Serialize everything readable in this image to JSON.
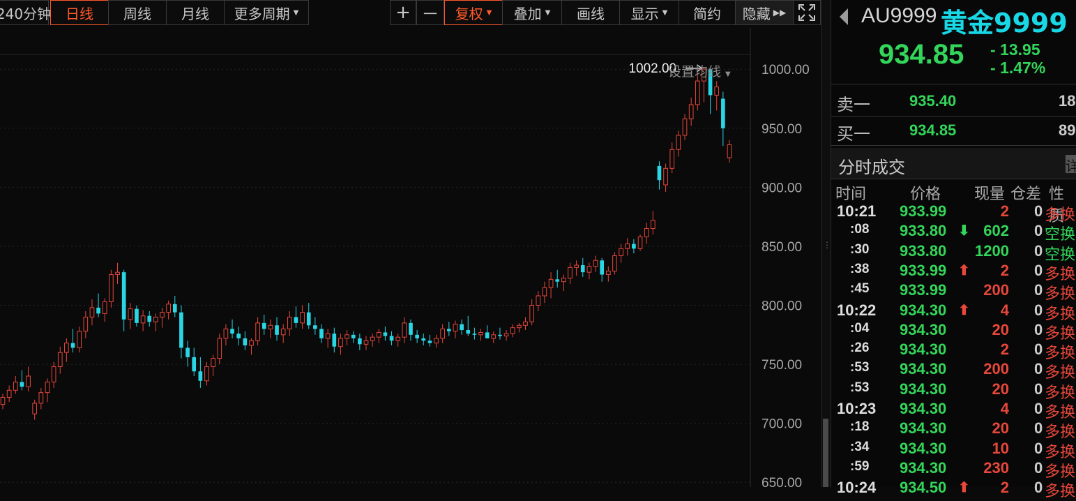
{
  "toolbar": {
    "period_240": "240分钟",
    "daily": "日线",
    "weekly": "周线",
    "monthly": "月线",
    "more_periods": "更多周期",
    "zoom_in": "+",
    "zoom_out": "一",
    "adjust": "复权",
    "overlay": "叠加",
    "draw": "画线",
    "display": "显示",
    "simple": "简约",
    "hide": "隐藏",
    "expand_icon": "expand-icon",
    "accent_color": "#ff5a2a"
  },
  "chart": {
    "ma_setting_label": "设置均线",
    "max_label": "1002.00",
    "y_ticks": [
      "1000.00",
      "950.00",
      "900.00",
      "850.00",
      "800.00",
      "750.00",
      "700.00",
      "650.00"
    ],
    "up_color": "#e8473b",
    "down_color": "#2ad6e4"
  },
  "chart_data": {
    "type": "candlestick",
    "y_ticks": [
      1000,
      950,
      900,
      850,
      800,
      750,
      700,
      650
    ],
    "ylim": [
      646,
      1035
    ],
    "highest_annotation": 1002.0,
    "candles": [
      {
        "o": 716,
        "h": 725,
        "l": 712,
        "c": 722
      },
      {
        "o": 722,
        "h": 732,
        "l": 718,
        "c": 728
      },
      {
        "o": 728,
        "h": 740,
        "l": 725,
        "c": 735
      },
      {
        "o": 735,
        "h": 745,
        "l": 728,
        "c": 731
      },
      {
        "o": 731,
        "h": 748,
        "l": 727,
        "c": 740
      },
      {
        "o": 708,
        "h": 720,
        "l": 703,
        "c": 717
      },
      {
        "o": 717,
        "h": 730,
        "l": 712,
        "c": 726
      },
      {
        "o": 726,
        "h": 738,
        "l": 718,
        "c": 735
      },
      {
        "o": 735,
        "h": 752,
        "l": 730,
        "c": 748
      },
      {
        "o": 748,
        "h": 765,
        "l": 742,
        "c": 760
      },
      {
        "o": 760,
        "h": 772,
        "l": 752,
        "c": 768
      },
      {
        "o": 768,
        "h": 780,
        "l": 760,
        "c": 764
      },
      {
        "o": 764,
        "h": 782,
        "l": 760,
        "c": 778
      },
      {
        "o": 778,
        "h": 795,
        "l": 772,
        "c": 790
      },
      {
        "o": 790,
        "h": 805,
        "l": 783,
        "c": 798
      },
      {
        "o": 798,
        "h": 810,
        "l": 790,
        "c": 793
      },
      {
        "o": 793,
        "h": 806,
        "l": 786,
        "c": 803
      },
      {
        "o": 803,
        "h": 830,
        "l": 798,
        "c": 826
      },
      {
        "o": 826,
        "h": 836,
        "l": 818,
        "c": 828
      },
      {
        "o": 828,
        "h": 830,
        "l": 778,
        "c": 788
      },
      {
        "o": 788,
        "h": 802,
        "l": 780,
        "c": 797
      },
      {
        "o": 797,
        "h": 800,
        "l": 782,
        "c": 785
      },
      {
        "o": 785,
        "h": 796,
        "l": 778,
        "c": 791
      },
      {
        "o": 791,
        "h": 795,
        "l": 782,
        "c": 786
      },
      {
        "o": 786,
        "h": 793,
        "l": 778,
        "c": 790
      },
      {
        "o": 790,
        "h": 798,
        "l": 781,
        "c": 794
      },
      {
        "o": 794,
        "h": 804,
        "l": 788,
        "c": 801
      },
      {
        "o": 801,
        "h": 808,
        "l": 790,
        "c": 794
      },
      {
        "o": 794,
        "h": 800,
        "l": 755,
        "c": 764
      },
      {
        "o": 764,
        "h": 770,
        "l": 748,
        "c": 756
      },
      {
        "o": 756,
        "h": 764,
        "l": 740,
        "c": 744
      },
      {
        "o": 744,
        "h": 756,
        "l": 730,
        "c": 736
      },
      {
        "o": 736,
        "h": 752,
        "l": 732,
        "c": 748
      },
      {
        "o": 748,
        "h": 758,
        "l": 740,
        "c": 755
      },
      {
        "o": 755,
        "h": 776,
        "l": 750,
        "c": 772
      },
      {
        "o": 772,
        "h": 784,
        "l": 766,
        "c": 780
      },
      {
        "o": 780,
        "h": 788,
        "l": 772,
        "c": 776
      },
      {
        "o": 776,
        "h": 782,
        "l": 766,
        "c": 772
      },
      {
        "o": 772,
        "h": 778,
        "l": 762,
        "c": 766
      },
      {
        "o": 766,
        "h": 772,
        "l": 758,
        "c": 770
      },
      {
        "o": 770,
        "h": 790,
        "l": 766,
        "c": 785
      },
      {
        "o": 785,
        "h": 792,
        "l": 775,
        "c": 780
      },
      {
        "o": 780,
        "h": 788,
        "l": 772,
        "c": 783
      },
      {
        "o": 783,
        "h": 790,
        "l": 770,
        "c": 775
      },
      {
        "o": 775,
        "h": 784,
        "l": 768,
        "c": 780
      },
      {
        "o": 780,
        "h": 795,
        "l": 774,
        "c": 790
      },
      {
        "o": 790,
        "h": 799,
        "l": 781,
        "c": 785
      },
      {
        "o": 785,
        "h": 800,
        "l": 780,
        "c": 794
      },
      {
        "o": 794,
        "h": 802,
        "l": 780,
        "c": 783
      },
      {
        "o": 783,
        "h": 790,
        "l": 775,
        "c": 780
      },
      {
        "o": 780,
        "h": 784,
        "l": 768,
        "c": 772
      },
      {
        "o": 772,
        "h": 780,
        "l": 764,
        "c": 776
      },
      {
        "o": 776,
        "h": 781,
        "l": 760,
        "c": 765
      },
      {
        "o": 765,
        "h": 776,
        "l": 758,
        "c": 772
      },
      {
        "o": 772,
        "h": 779,
        "l": 766,
        "c": 775
      },
      {
        "o": 775,
        "h": 778,
        "l": 768,
        "c": 772
      },
      {
        "o": 772,
        "h": 776,
        "l": 762,
        "c": 767
      },
      {
        "o": 767,
        "h": 774,
        "l": 762,
        "c": 770
      },
      {
        "o": 770,
        "h": 776,
        "l": 765,
        "c": 773
      },
      {
        "o": 773,
        "h": 780,
        "l": 768,
        "c": 777
      },
      {
        "o": 777,
        "h": 782,
        "l": 770,
        "c": 774
      },
      {
        "o": 774,
        "h": 778,
        "l": 766,
        "c": 770
      },
      {
        "o": 770,
        "h": 776,
        "l": 765,
        "c": 773
      },
      {
        "o": 773,
        "h": 790,
        "l": 768,
        "c": 785
      },
      {
        "o": 785,
        "h": 788,
        "l": 770,
        "c": 775
      },
      {
        "o": 775,
        "h": 779,
        "l": 768,
        "c": 772
      },
      {
        "o": 772,
        "h": 776,
        "l": 766,
        "c": 770
      },
      {
        "o": 770,
        "h": 775,
        "l": 765,
        "c": 768
      },
      {
        "o": 768,
        "h": 775,
        "l": 764,
        "c": 772
      },
      {
        "o": 772,
        "h": 784,
        "l": 768,
        "c": 780
      },
      {
        "o": 780,
        "h": 786,
        "l": 774,
        "c": 778
      },
      {
        "o": 778,
        "h": 787,
        "l": 772,
        "c": 784
      },
      {
        "o": 784,
        "h": 788,
        "l": 775,
        "c": 779
      },
      {
        "o": 779,
        "h": 791,
        "l": 774,
        "c": 776
      },
      {
        "o": 776,
        "h": 781,
        "l": 771,
        "c": 775
      },
      {
        "o": 775,
        "h": 780,
        "l": 770,
        "c": 777
      },
      {
        "o": 777,
        "h": 783,
        "l": 772,
        "c": 772
      },
      {
        "o": 772,
        "h": 778,
        "l": 768,
        "c": 775
      },
      {
        "o": 775,
        "h": 781,
        "l": 771,
        "c": 774
      },
      {
        "o": 774,
        "h": 779,
        "l": 770,
        "c": 776
      },
      {
        "o": 776,
        "h": 784,
        "l": 773,
        "c": 781
      },
      {
        "o": 781,
        "h": 785,
        "l": 777,
        "c": 783
      },
      {
        "o": 783,
        "h": 790,
        "l": 779,
        "c": 786
      },
      {
        "o": 786,
        "h": 805,
        "l": 783,
        "c": 800
      },
      {
        "o": 800,
        "h": 812,
        "l": 795,
        "c": 808
      },
      {
        "o": 808,
        "h": 820,
        "l": 802,
        "c": 815
      },
      {
        "o": 815,
        "h": 828,
        "l": 806,
        "c": 822
      },
      {
        "o": 822,
        "h": 830,
        "l": 815,
        "c": 820
      },
      {
        "o": 820,
        "h": 826,
        "l": 812,
        "c": 823
      },
      {
        "o": 823,
        "h": 836,
        "l": 818,
        "c": 832
      },
      {
        "o": 832,
        "h": 838,
        "l": 825,
        "c": 834
      },
      {
        "o": 834,
        "h": 840,
        "l": 824,
        "c": 828
      },
      {
        "o": 828,
        "h": 836,
        "l": 822,
        "c": 833
      },
      {
        "o": 833,
        "h": 842,
        "l": 828,
        "c": 838
      },
      {
        "o": 838,
        "h": 840,
        "l": 820,
        "c": 826
      },
      {
        "o": 826,
        "h": 833,
        "l": 820,
        "c": 829
      },
      {
        "o": 829,
        "h": 845,
        "l": 826,
        "c": 842
      },
      {
        "o": 842,
        "h": 852,
        "l": 836,
        "c": 848
      },
      {
        "o": 848,
        "h": 857,
        "l": 842,
        "c": 852
      },
      {
        "o": 852,
        "h": 856,
        "l": 844,
        "c": 848
      },
      {
        "o": 848,
        "h": 860,
        "l": 846,
        "c": 858
      },
      {
        "o": 858,
        "h": 870,
        "l": 852,
        "c": 865
      },
      {
        "o": 865,
        "h": 880,
        "l": 860,
        "c": 872
      },
      {
        "o": 918,
        "h": 922,
        "l": 898,
        "c": 906
      },
      {
        "o": 902,
        "h": 920,
        "l": 896,
        "c": 916
      },
      {
        "o": 916,
        "h": 938,
        "l": 912,
        "c": 932
      },
      {
        "o": 932,
        "h": 948,
        "l": 926,
        "c": 944
      },
      {
        "o": 944,
        "h": 962,
        "l": 940,
        "c": 958
      },
      {
        "o": 958,
        "h": 976,
        "l": 952,
        "c": 970
      },
      {
        "o": 970,
        "h": 995,
        "l": 965,
        "c": 990
      },
      {
        "o": 990,
        "h": 1002,
        "l": 972,
        "c": 1000
      },
      {
        "o": 1000,
        "h": 1001,
        "l": 962,
        "c": 978
      },
      {
        "o": 978,
        "h": 990,
        "l": 965,
        "c": 985
      },
      {
        "o": 975,
        "h": 981,
        "l": 935,
        "c": 950
      },
      {
        "o": 925,
        "h": 940,
        "l": 921,
        "c": 936
      }
    ]
  },
  "quote": {
    "back_icon": "back-arrow-icon",
    "code": "AU9999",
    "name": "黄金9999",
    "price": "934.85",
    "change": "- 13.95",
    "change_pct": "- 1.47%",
    "down_color": "#33d65a",
    "ask_label": "卖一",
    "ask_price": "935.40",
    "ask_qty": "18",
    "bid_label": "买一",
    "bid_price": "934.85",
    "bid_qty": "89",
    "ticks_title": "分时成交",
    "detail_btn": "详",
    "col_time": "时间",
    "col_price": "价格",
    "col_vol": "现量",
    "col_oi": "仓差",
    "col_nature": "性质"
  },
  "trades": [
    {
      "time": "10:21",
      "price": "933.99",
      "arrow": "",
      "vol": "2",
      "oi": "0",
      "nature": "多换",
      "major": true
    },
    {
      "time": ":08",
      "price": "933.80",
      "arrow": "⬇",
      "vol": "602",
      "oi": "0",
      "nature": "空换",
      "major": false
    },
    {
      "time": ":30",
      "price": "933.80",
      "arrow": "",
      "vol": "1200",
      "oi": "0",
      "nature": "空换",
      "major": false
    },
    {
      "time": ":38",
      "price": "933.99",
      "arrow": "⬆",
      "vol": "2",
      "oi": "0",
      "nature": "多换",
      "major": false
    },
    {
      "time": ":45",
      "price": "933.99",
      "arrow": "",
      "vol": "200",
      "oi": "0",
      "nature": "多换",
      "major": false
    },
    {
      "time": "10:22",
      "price": "934.30",
      "arrow": "⬆",
      "vol": "4",
      "oi": "0",
      "nature": "多换",
      "major": true
    },
    {
      "time": ":04",
      "price": "934.30",
      "arrow": "",
      "vol": "20",
      "oi": "0",
      "nature": "多换",
      "major": false
    },
    {
      "time": ":26",
      "price": "934.30",
      "arrow": "",
      "vol": "2",
      "oi": "0",
      "nature": "多换",
      "major": false
    },
    {
      "time": ":53",
      "price": "934.30",
      "arrow": "",
      "vol": "200",
      "oi": "0",
      "nature": "多换",
      "major": false
    },
    {
      "time": ":53",
      "price": "934.30",
      "arrow": "",
      "vol": "20",
      "oi": "0",
      "nature": "多换",
      "major": false
    },
    {
      "time": "10:23",
      "price": "934.30",
      "arrow": "",
      "vol": "4",
      "oi": "0",
      "nature": "多换",
      "major": true
    },
    {
      "time": ":18",
      "price": "934.30",
      "arrow": "",
      "vol": "20",
      "oi": "0",
      "nature": "多换",
      "major": false
    },
    {
      "time": ":34",
      "price": "934.30",
      "arrow": "",
      "vol": "10",
      "oi": "0",
      "nature": "多换",
      "major": false
    },
    {
      "time": ":59",
      "price": "934.30",
      "arrow": "",
      "vol": "230",
      "oi": "0",
      "nature": "多换",
      "major": false
    },
    {
      "time": "10:24",
      "price": "934.50",
      "arrow": "⬆",
      "vol": "2",
      "oi": "0",
      "nature": "多换",
      "major": true
    }
  ]
}
